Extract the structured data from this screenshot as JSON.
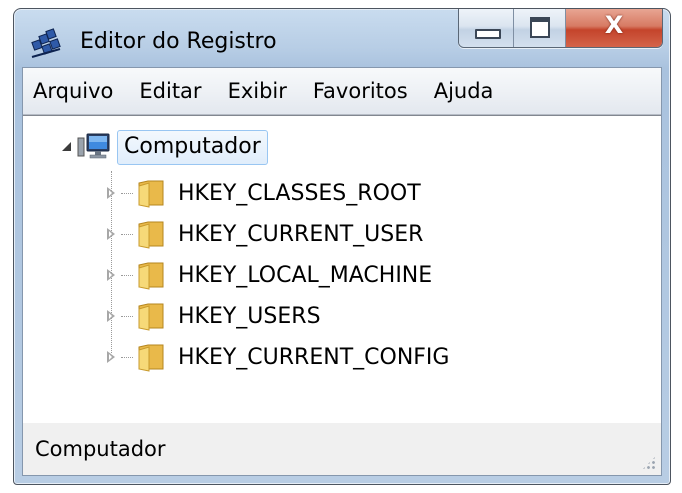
{
  "window": {
    "title": "Editor do Registro",
    "close_glyph": "X",
    "accent_close": "#c4442b",
    "frame_color": "#b7cde5"
  },
  "menubar": {
    "items": [
      "Arquivo",
      "Editar",
      "Exibir",
      "Favoritos",
      "Ajuda"
    ]
  },
  "tree": {
    "root": {
      "label": "Computador",
      "icon": "computer-icon",
      "expanded": true,
      "selected": true
    },
    "children": [
      {
        "label": "HKEY_CLASSES_ROOT",
        "icon": "folder-icon"
      },
      {
        "label": "HKEY_CURRENT_USER",
        "icon": "folder-icon"
      },
      {
        "label": "HKEY_LOCAL_MACHINE",
        "icon": "folder-icon"
      },
      {
        "label": "HKEY_USERS",
        "icon": "folder-icon"
      },
      {
        "label": "HKEY_CURRENT_CONFIG",
        "icon": "folder-icon"
      }
    ]
  },
  "statusbar": {
    "text": "Computador"
  }
}
